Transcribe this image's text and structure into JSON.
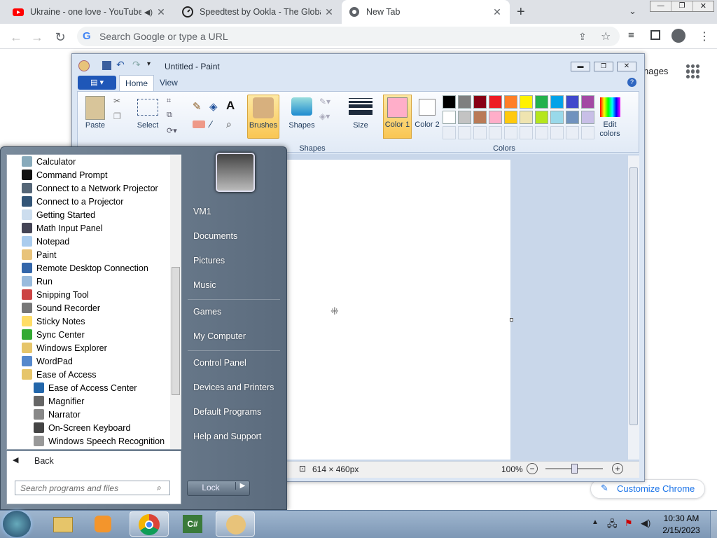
{
  "browser": {
    "tabs": [
      {
        "title": "Ukraine - one love - YouTube",
        "close": "✕"
      },
      {
        "title": "Speedtest by Ookla - The Global",
        "close": "✕"
      },
      {
        "title": "New Tab",
        "close": "✕"
      }
    ],
    "new_tab": "+",
    "omnibox_placeholder": "Search Google or type a URL",
    "right_partial": "nages",
    "customize": "Customize Chrome"
  },
  "paint": {
    "title": "Untitled - Paint",
    "tabs": [
      "Home",
      "View"
    ],
    "groups": {
      "clipboard": "Paste",
      "image": "Select",
      "brushes": "Brushes",
      "shapes": "Shapes",
      "shapes_label": "Shapes",
      "size": "Size",
      "color1": "Color 1",
      "color2": "Color 2",
      "edit": "Edit colors",
      "colors_label": "Colors"
    },
    "palette": [
      "#000000",
      "#7f7f7f",
      "#880015",
      "#ed1c24",
      "#ff7f27",
      "#fff200",
      "#22b14c",
      "#00a2e8",
      "#3f48cc",
      "#a349a4",
      "#ffffff",
      "#c3c3c3",
      "#b97a57",
      "#ffaec9",
      "#ffc90e",
      "#efe4b0",
      "#b5e61d",
      "#99d9ea",
      "#7092be",
      "#c8bfe7"
    ],
    "color1": "#ffaec9",
    "color2": "#ffffff",
    "status_size": "614 × 460px",
    "zoom": "100%"
  },
  "startmenu": {
    "programs": [
      "Calculator",
      "Command Prompt",
      "Connect to a Network Projector",
      "Connect to a Projector",
      "Getting Started",
      "Math Input Panel",
      "Notepad",
      "Paint",
      "Remote Desktop Connection",
      "Run",
      "Snipping Tool",
      "Sound Recorder",
      "Sticky Notes",
      "Sync Center",
      "Windows Explorer",
      "WordPad",
      "Ease of Access",
      "Ease of Access Center",
      "Magnifier",
      "Narrator",
      "On-Screen Keyboard",
      "Windows Speech Recognition"
    ],
    "back": "Back",
    "search_placeholder": "Search programs and files",
    "right": [
      "VM1",
      "Documents",
      "Pictures",
      "Music",
      "Games",
      "My Computer",
      "Control Panel",
      "Devices and Printers",
      "Default Programs",
      "Help and Support"
    ],
    "lock": "Lock"
  },
  "taskbar": {
    "time": "10:30 AM",
    "date": "2/15/2023"
  }
}
